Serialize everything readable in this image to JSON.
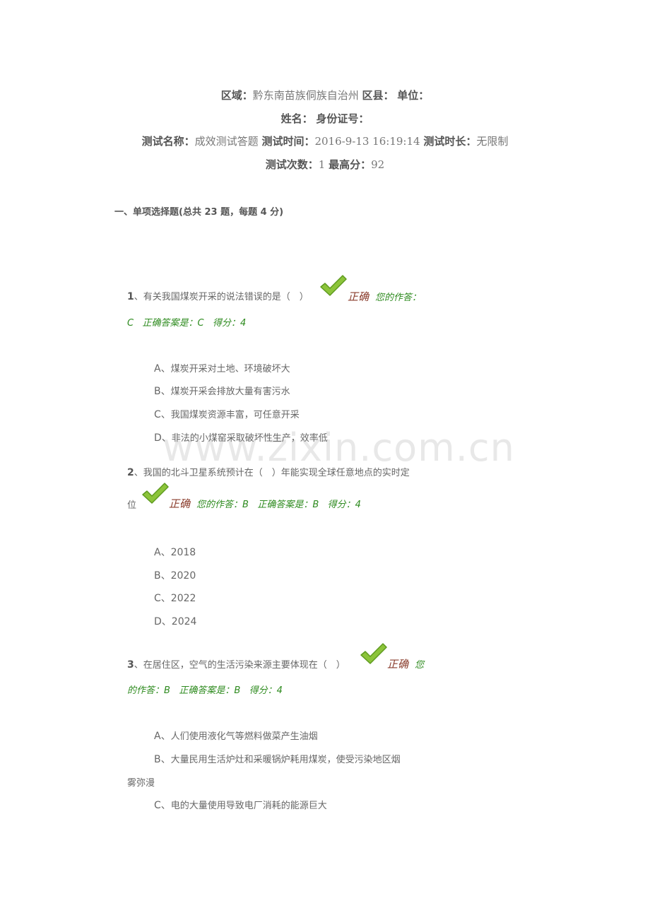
{
  "header": {
    "region_label": "区域：",
    "region_value": "黔东南苗族侗族自治州",
    "county_label": "区县：",
    "unit_label": "单位：",
    "name_label": "姓名：",
    "id_label": "身份证号：",
    "test_name_label": "测试名称：",
    "test_name_value": "成效测试答题",
    "test_time_label": "测试时间：",
    "test_time_value": "2016-9-13 16:19:14",
    "duration_label": "测试时长：",
    "duration_value": "无限制",
    "attempts_label": "测试次数：",
    "attempts_value": "1",
    "best_label": "最高分：",
    "best_value": "92"
  },
  "section_title": "一、单项选择题(总共 23 题，每题 4 分)",
  "watermark": "www.zixin.com.cn",
  "questions": [
    {
      "num": "1",
      "text": "、有关我国煤炭开采的说法错误的是（　）",
      "result": "正确",
      "your_answer_label": "您的作答：",
      "your_answer": "C",
      "correct_answer_label": "正确答案是：C",
      "score_label": "得分：4",
      "options": [
        {
          "letter": "A",
          "text": "煤炭开采对土地、环境破坏大"
        },
        {
          "letter": "B",
          "text": "煤炭开采会排放大量有害污水"
        },
        {
          "letter": "C",
          "text": "我国煤炭资源丰富，可任意开采"
        },
        {
          "letter": "D",
          "text": "非法的小煤窑采取破坏性生产，效率低"
        }
      ]
    },
    {
      "num": "2",
      "text": "、我国的北斗卫星系统预计在（　）年能实现全球任意地点的实时定",
      "text_cont": "位",
      "result": "正确",
      "your_answer_label": "您的作答：B",
      "correct_answer_label": "正确答案是：B",
      "score_label": "得分：4",
      "options": [
        {
          "letter": "A",
          "text": "2018"
        },
        {
          "letter": "B",
          "text": "2020"
        },
        {
          "letter": "C",
          "text": "2022"
        },
        {
          "letter": "D",
          "text": "2024"
        }
      ]
    },
    {
      "num": "3",
      "text": "、在居住区，空气的生活污染来源主要体现在（　）",
      "result": "正确",
      "your_answer_label_a": "您",
      "your_answer_label_b": "的作答：B",
      "correct_answer_label": "正确答案是：B",
      "score_label": "得分：4",
      "options": [
        {
          "letter": "A",
          "text": "人们使用液化气等燃料做菜产生油烟"
        },
        {
          "letter": "B",
          "text": "大量民用生活炉灶和采暖锅炉耗用煤炭，使受污染地区烟",
          "text_cont": "雾弥漫"
        },
        {
          "letter": "C",
          "text": "电的大量使用导致电厂消耗的能源巨大"
        }
      ]
    }
  ]
}
